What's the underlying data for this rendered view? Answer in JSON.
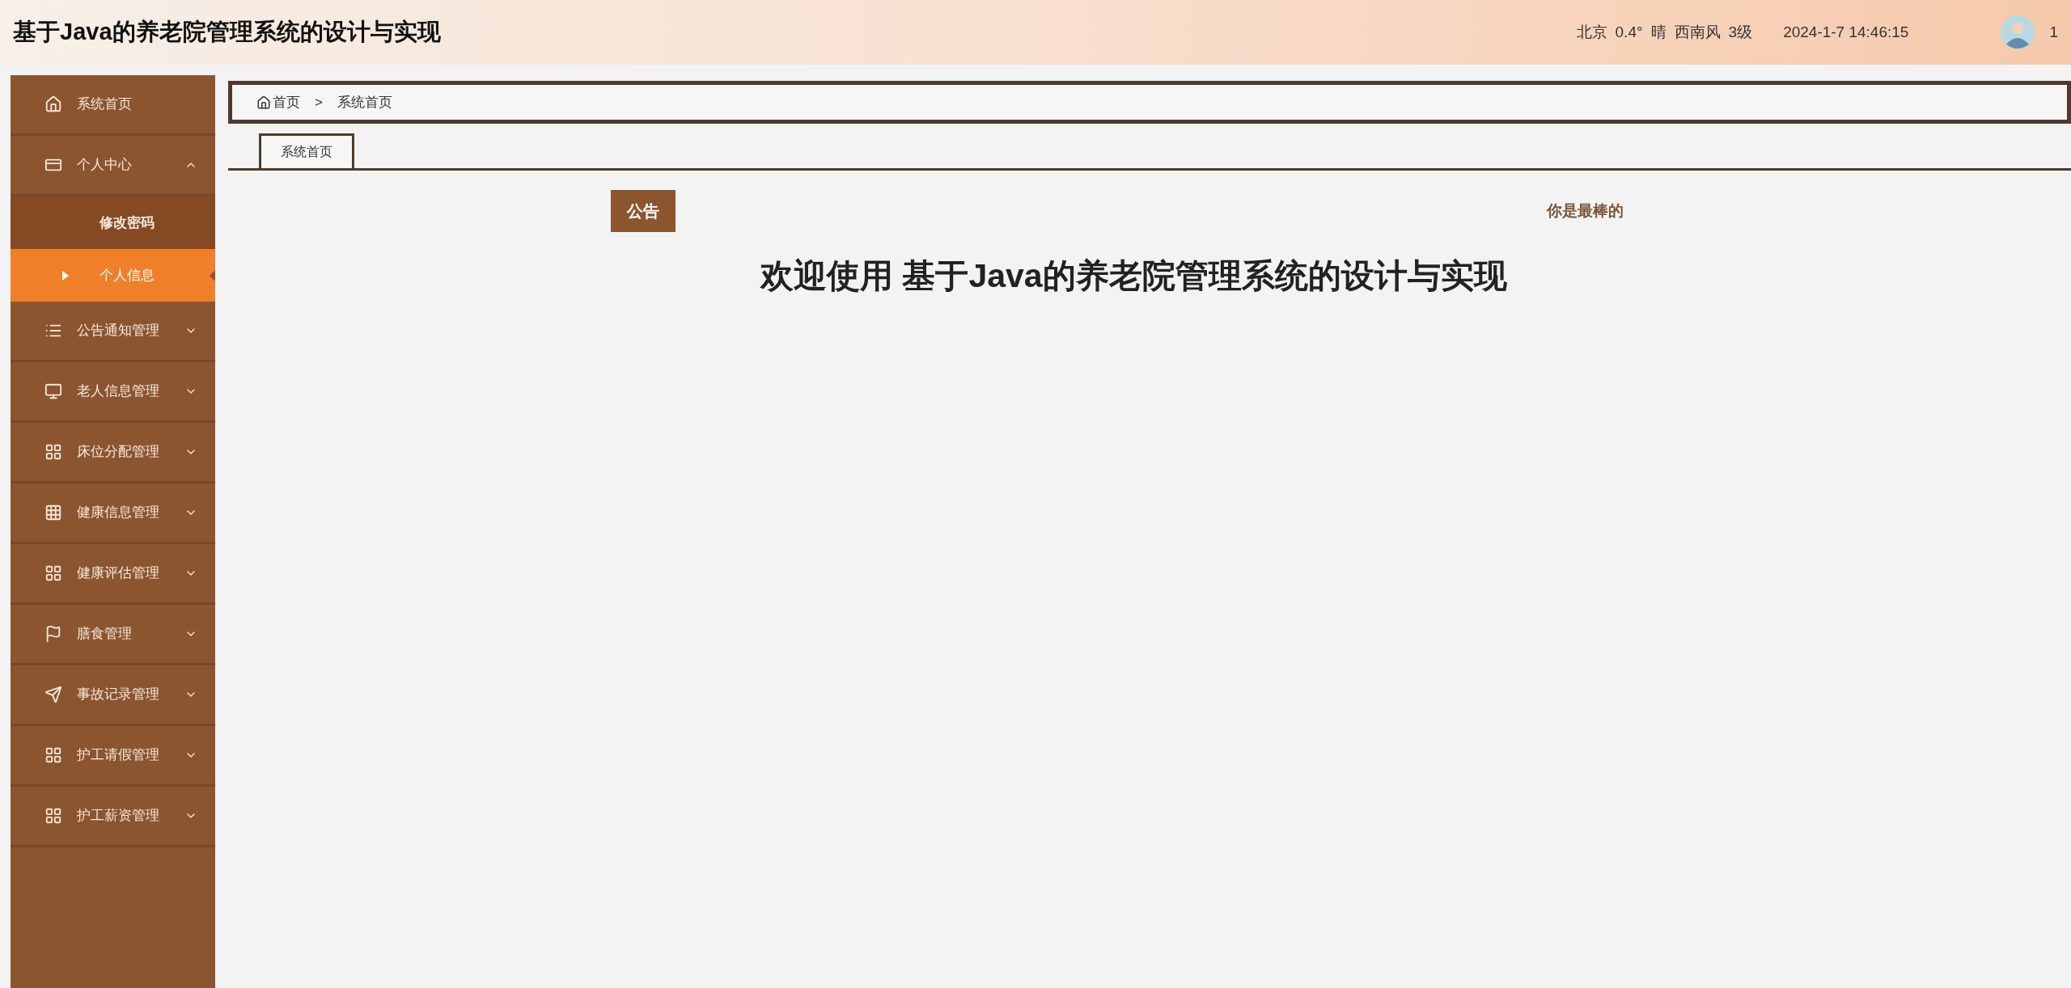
{
  "header": {
    "title": "基于Java的养老院管理系统的设计与实现",
    "weather": [
      "北京",
      "0.4°",
      "晴",
      "西南风",
      "3级"
    ],
    "datetime": "2024-1-7 14:46:15",
    "user": "1"
  },
  "sidebar": {
    "items": [
      {
        "label": "系统首页",
        "expandable": false
      },
      {
        "label": "个人中心",
        "expandable": true,
        "expanded": true,
        "children": [
          {
            "label": "修改密码",
            "selected": false
          },
          {
            "label": "个人信息",
            "selected": true
          }
        ]
      },
      {
        "label": "公告通知管理",
        "expandable": true,
        "expanded": false
      },
      {
        "label": "老人信息管理",
        "expandable": true,
        "expanded": false
      },
      {
        "label": "床位分配管理",
        "expandable": true,
        "expanded": false
      },
      {
        "label": "健康信息管理",
        "expandable": true,
        "expanded": false
      },
      {
        "label": "健康评估管理",
        "expandable": true,
        "expanded": false
      },
      {
        "label": "膳食管理",
        "expandable": true,
        "expanded": false
      },
      {
        "label": "事故记录管理",
        "expandable": true,
        "expanded": false
      },
      {
        "label": "护工请假管理",
        "expandable": true,
        "expanded": false
      },
      {
        "label": "护工薪资管理",
        "expandable": true,
        "expanded": false
      }
    ]
  },
  "breadcrumb": [
    "首页",
    ">",
    "系统首页"
  ],
  "tabs": [
    {
      "label": "系统首页",
      "selected": true
    }
  ],
  "notice": {
    "badge": "公告",
    "text": "你是最棒的"
  },
  "welcome": "欢迎使用 基于Java的养老院管理系统的设计与实现"
}
